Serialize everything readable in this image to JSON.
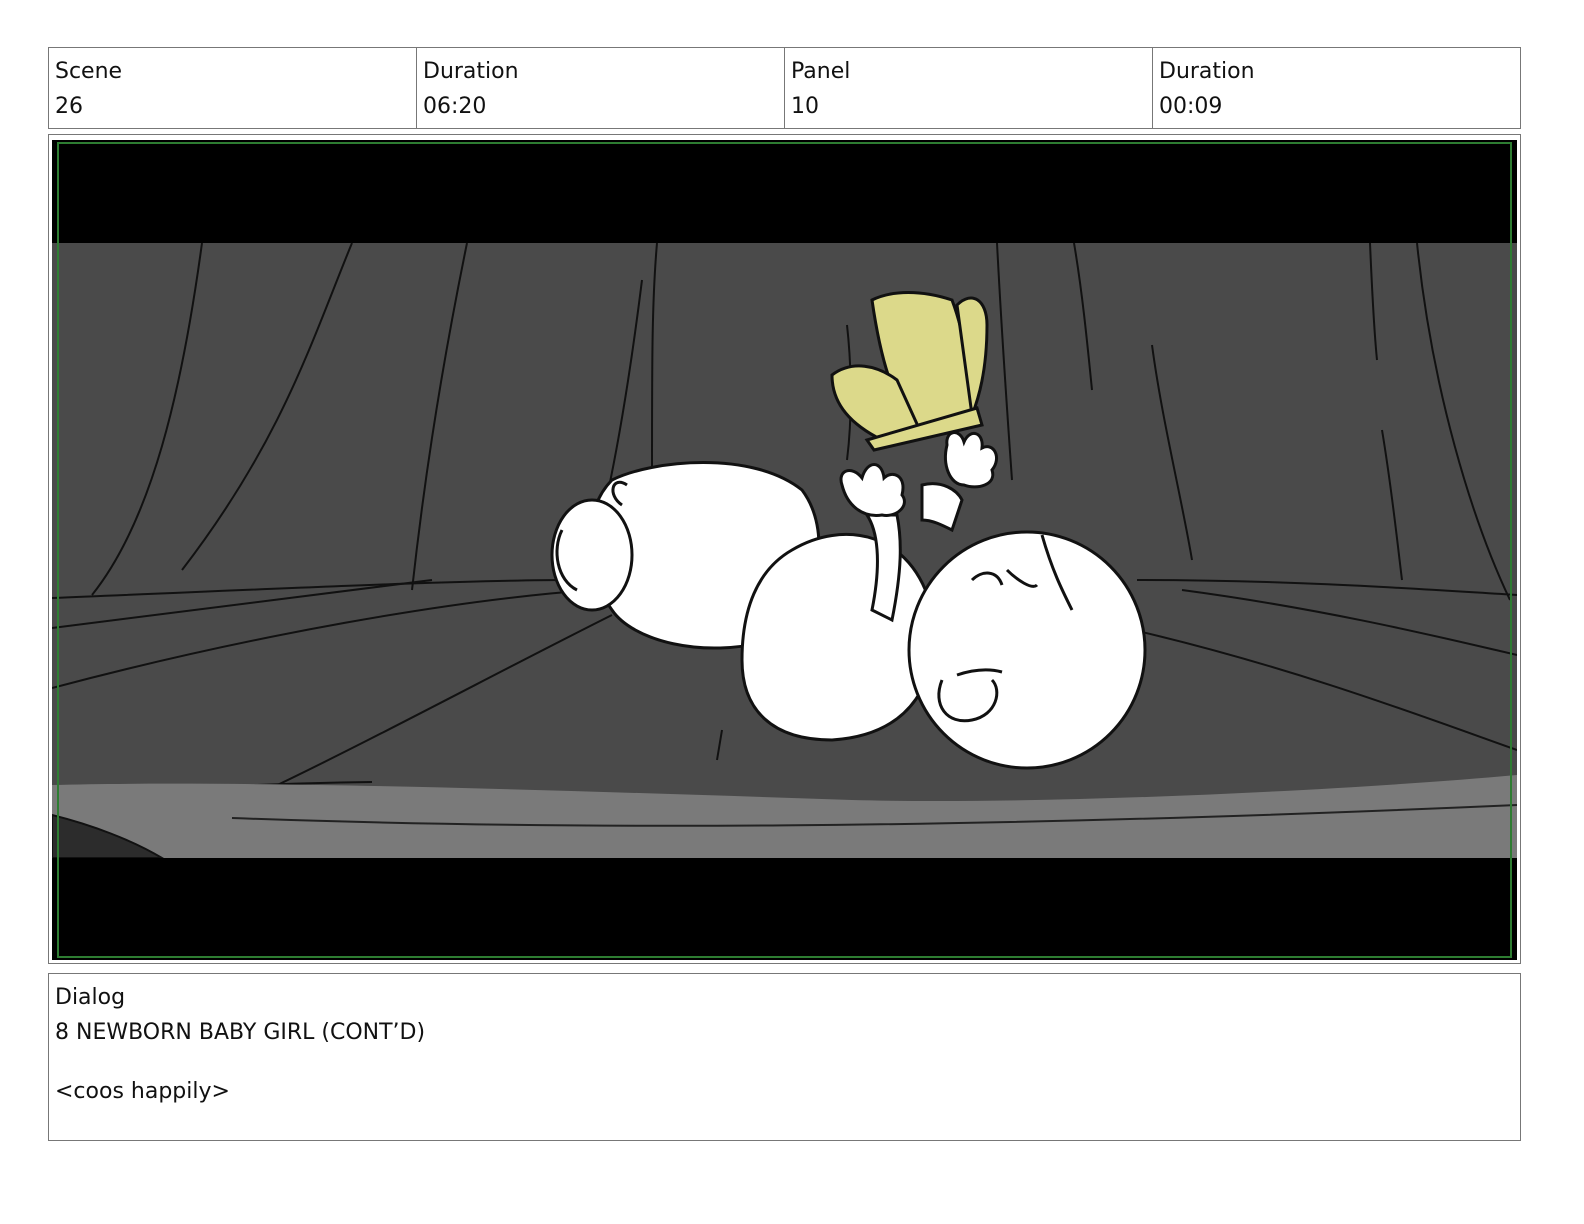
{
  "header": {
    "scene": {
      "label": "Scene",
      "value": "26"
    },
    "scene_duration": {
      "label": "Duration",
      "value": "06:20"
    },
    "panel": {
      "label": "Panel",
      "value": "10"
    },
    "panel_duration": {
      "label": "Duration",
      "value": "00:09"
    }
  },
  "dialog": {
    "label": "Dialog",
    "character": "8 NEWBORN BABY GIRL (CONT’D)",
    "line": "<coos happily>"
  },
  "colors": {
    "letterbox": "#000000",
    "backdrop": "#4a4a4a",
    "floor_strip": "#7a7a7a",
    "crown": "#dcd98a",
    "safe_frame": "#2e7d32"
  }
}
